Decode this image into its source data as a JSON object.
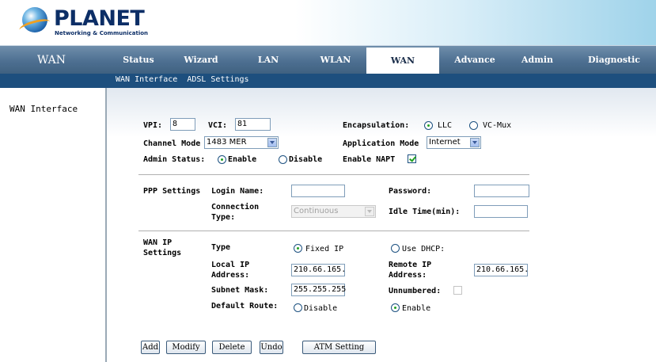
{
  "brand": {
    "name": "PLANET",
    "tagline": "Networking & Communication"
  },
  "nav": {
    "title": "WAN",
    "tabs": [
      {
        "label": "Status"
      },
      {
        "label": "Wizard"
      },
      {
        "label": "LAN"
      },
      {
        "label": "WLAN"
      },
      {
        "label": "WAN",
        "active": true
      },
      {
        "label": "Advance"
      },
      {
        "label": "Admin"
      },
      {
        "label": "Diagnostic"
      }
    ]
  },
  "subnav": {
    "links": [
      "WAN Interface",
      "ADSL Settings"
    ]
  },
  "sidebar": {
    "items": [
      {
        "label": "WAN Interface"
      }
    ]
  },
  "form": {
    "vpi_label": "VPI:",
    "vpi_value": "8",
    "vci_label": "VCI:",
    "vci_value": "81",
    "encapsulation_label": "Encapsulation:",
    "encap_llc": "LLC",
    "encap_vcmux": "VC-Mux",
    "channel_mode_label": "Channel Mode",
    "channel_mode_value": "1483 MER",
    "application_mode_label": "Application Mode",
    "application_mode_value": "Internet",
    "admin_status_label": "Admin Status:",
    "admin_enable": "Enable",
    "admin_disable": "Disable",
    "enable_napt_label": "Enable NAPT",
    "ppp_settings_label": "PPP Settings",
    "login_name_label": "Login Name:",
    "login_name_value": "",
    "password_label": "Password:",
    "password_value": "",
    "connection_type_label_1": "Connection",
    "connection_type_label_2": "Type:",
    "connection_type_value": "Continuous",
    "idle_time_label": "Idle Time(min):",
    "idle_time_value": "",
    "wan_ip_label_1": "WAN IP",
    "wan_ip_label_2": "Settings",
    "type_label": "Type",
    "fixed_ip_label": "Fixed IP",
    "use_dhcp_label": "Use DHCP:",
    "local_ip_label_1": "Local IP",
    "local_ip_label_2": "Address:",
    "local_ip_value": "210.66.165.",
    "remote_ip_label_1": "Remote IP",
    "remote_ip_label_2": "Address:",
    "remote_ip_value": "210.66.165.",
    "subnet_mask_label": "Subnet Mask:",
    "subnet_mask_value": "255.255.255",
    "unnumbered_label": "Unnumbered:",
    "default_route_label": "Default Route:",
    "route_disable": "Disable",
    "route_enable": "Enable"
  },
  "buttons": {
    "add": "Add",
    "modify": "Modify",
    "delete": "Delete",
    "undo": "Undo",
    "atm": "ATM Setting"
  },
  "colors": {
    "nav_bg": "#4d6f91",
    "subnav_bg": "#1d4f7e",
    "brand": "#0c2e66",
    "check_green": "#21a121"
  },
  "state": {
    "encapsulation": "LLC",
    "admin_status": "Enable",
    "enable_napt": true,
    "wan_ip_type": "Fixed IP",
    "unnumbered": false,
    "default_route": "Enable",
    "connection_type_disabled": true
  }
}
